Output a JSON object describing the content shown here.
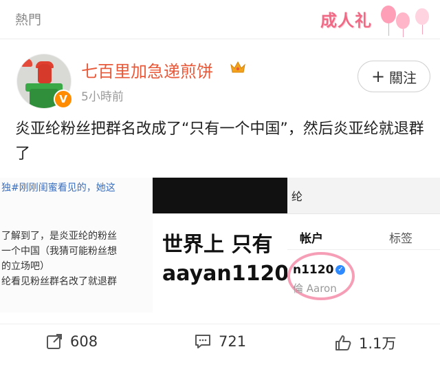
{
  "topbar": {
    "title": "熱門",
    "badge_text": "成人礼"
  },
  "post": {
    "username": "七百里加急递煎饼",
    "time": "5小時前",
    "follow_label": "關注",
    "text": "炎亚纶粉丝把群名改成了“只有一个中国”，然后炎亚纶就退群了",
    "image": {
      "left_lines": [
        "独#刚刚闺蜜看见的，她这",
        "了解到了，是炎亚纶的粉丝",
        "一个中国（我猜可能粉丝想",
        "的立场吧）",
        "纶看见粉丝群名改了就退群"
      ],
      "mid_line1": "世界上 只有",
      "mid_line2": "aayan1120",
      "right_header": "纶",
      "tab_account": "帐户",
      "tab_tags": "标签",
      "account_id": "n1120",
      "account_name": "倫 Aaron"
    }
  },
  "actions": {
    "repost_count": "608",
    "comment_count": "721",
    "like_count": "1.1万"
  },
  "colors": {
    "username": "#e8593a",
    "verified": "#ff8c00",
    "badge": "#f06a86"
  }
}
